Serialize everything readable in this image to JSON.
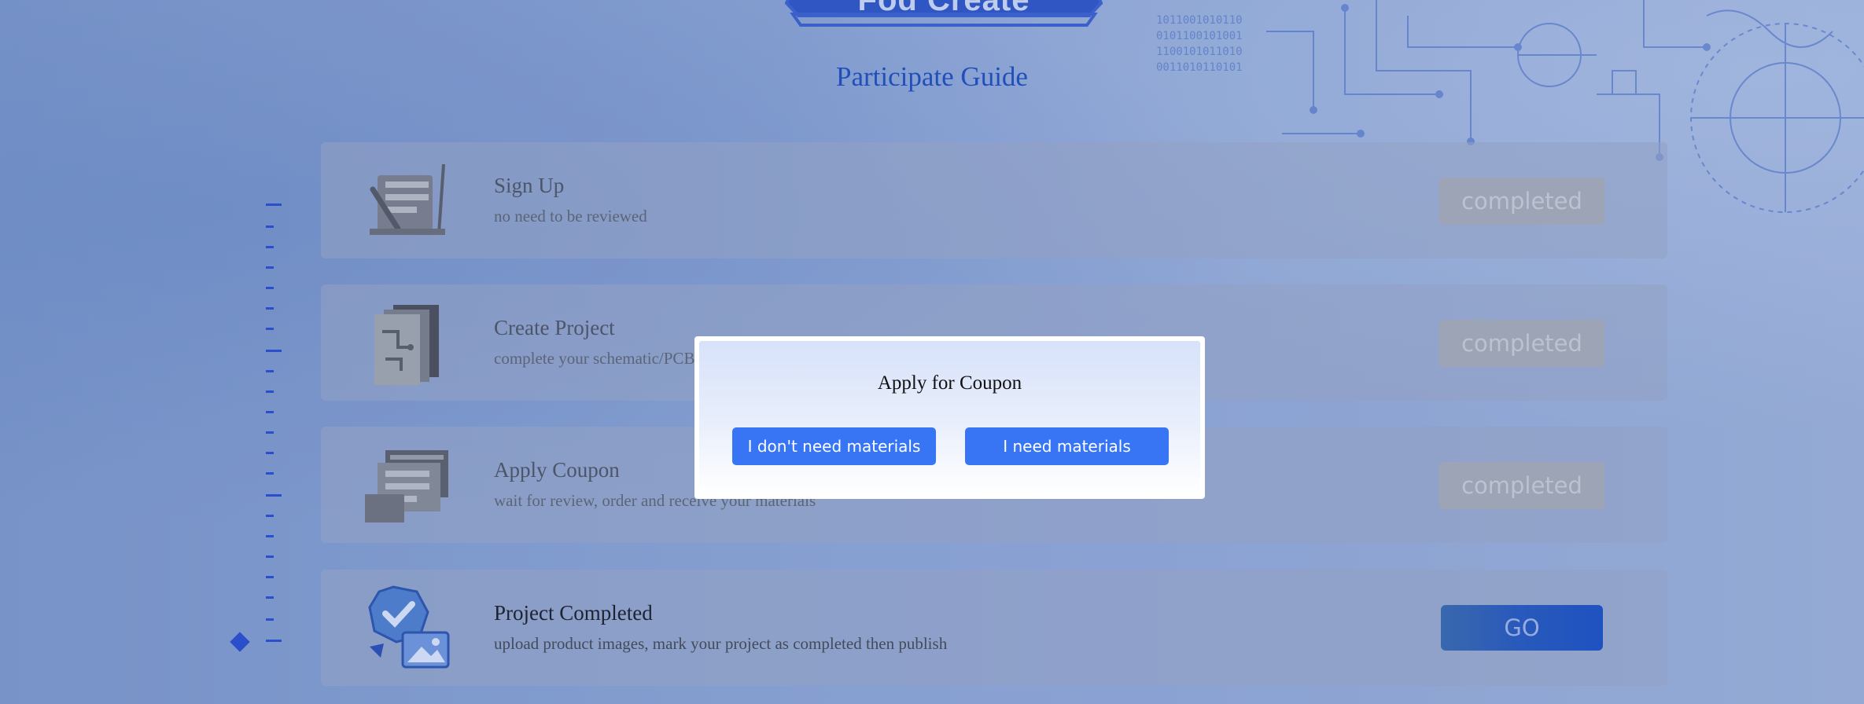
{
  "header": {
    "badge_text": "Fod Create",
    "title": "Participate Guide"
  },
  "steps": [
    {
      "title": "Sign Up",
      "desc": "no need to be reviewed",
      "status": "completed",
      "icon": "pen-clipboard-icon"
    },
    {
      "title": "Create Project",
      "desc": "complete your schematic/PCB",
      "status": "completed",
      "icon": "schematic-doc-icon"
    },
    {
      "title": "Apply Coupon",
      "desc": "wait for review, order and receive your materials",
      "status": "completed",
      "icon": "coupon-ticket-icon"
    },
    {
      "title": "Project Completed",
      "desc": "upload product images, mark your project as completed then publish",
      "status": "GO",
      "icon": "verified-badge-image-icon"
    }
  ],
  "modal": {
    "title": "Apply for Coupon",
    "no_materials_label": "I don't need materials",
    "need_materials_label": "I need materials"
  },
  "colors": {
    "accent": "#3775f5",
    "title_blue": "#1f4fbe",
    "timeline": "#2a4fd1",
    "completed_bg": "#a5abb9"
  }
}
